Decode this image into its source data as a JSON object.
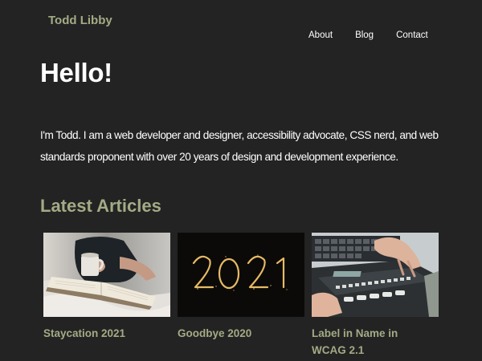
{
  "site": {
    "title": "Todd Libby"
  },
  "nav": {
    "items": [
      {
        "label": "About"
      },
      {
        "label": "Blog"
      },
      {
        "label": "Contact"
      }
    ]
  },
  "hero": {
    "title": "Hello!",
    "intro": "I'm Todd. I am a web developer and designer, accessibility advocate, CSS nerd, and web standards proponent with over 20 years of design and development experience."
  },
  "articles": {
    "heading": "Latest Articles",
    "items": [
      {
        "title": "Staycation 2021",
        "image": "person-reading-book-with-mug-image"
      },
      {
        "title": "Goodbye 2020",
        "image": "sparkler-2021-image"
      },
      {
        "title": "Label in Name in WCAG 2.1",
        "image": "braille-display-keyboard-image"
      }
    ]
  },
  "colors": {
    "background": "#232323",
    "accent": "#a3ab85",
    "text": "#ffffff"
  }
}
